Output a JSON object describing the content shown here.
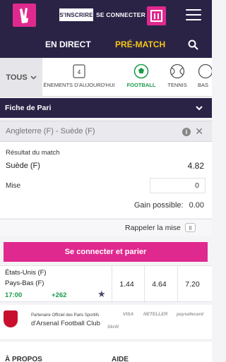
{
  "header": {
    "signup_label": "S'INSCRIRE",
    "login_label": "SE CONNECTER"
  },
  "tabs": {
    "live_label": "EN DIRECT",
    "prematch_label": "PRÉ-MATCH"
  },
  "sports_nav": {
    "all_label": "TOUS",
    "today_count": "4",
    "today_label": "ÉNEMENTS D'AUJOURD'HUI",
    "football_label": "FOOTBALL",
    "tennis_label": "TENNIS",
    "basket_label": "BAS"
  },
  "betslip": {
    "title": "Fiche de Pari",
    "match_name": "Angleterre (F) - Suède (F)",
    "market": "Résultat du match",
    "selection": "Suède (F)",
    "odd": "4.82",
    "stake_label": "Mise",
    "stake_value": "0",
    "gain_label": "Gain possible:",
    "gain_value": "0.00",
    "remind_label": "Rappeler la mise",
    "cta_label": "Se connecter et parier"
  },
  "match": {
    "team_home": "États-Unis (F)",
    "team_away": "Pays-Bas (F)",
    "time": "17:00",
    "more_markets": "+262",
    "odds": [
      "1.44",
      "4.64",
      "7.20"
    ]
  },
  "partner": {
    "small_text": "Partenaire Officiel des Paris Sportifs",
    "big_text": "d'Arsenal Football Club",
    "payments_row1": [
      "VISA",
      "NETELLER",
      "paysafecard"
    ],
    "payments_row2": [
      "Skrill"
    ]
  },
  "footer": {
    "col1": "À PROPOS",
    "col2": "AIDE"
  },
  "colors": {
    "header_bg": "#2a2346",
    "brand_pink": "#e0298f",
    "prematch_yellow": "#f5c518",
    "active_green": "#1a9a4a"
  }
}
